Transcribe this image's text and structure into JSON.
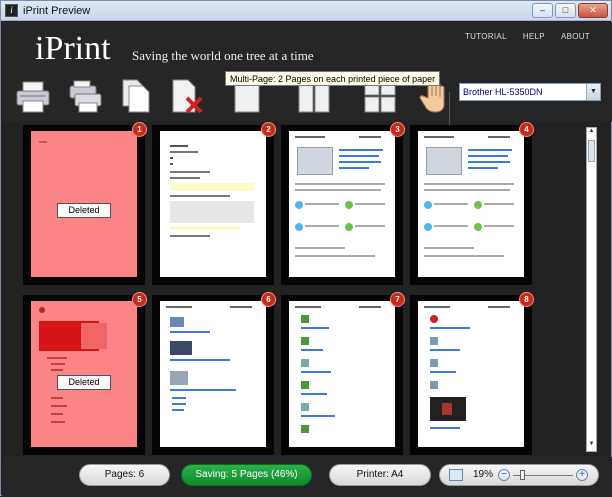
{
  "window": {
    "title": "iPrint Preview",
    "app_icon_letter": "i"
  },
  "header": {
    "logo": "iPrint",
    "tagline": "Saving the world one tree at a time",
    "nav": [
      "TUTORIAL",
      "HELP",
      "ABOUT"
    ]
  },
  "toolbar": {
    "tooltip": "Multi-Page: 2 Pages on each printed piece of paper",
    "printer": "Brother HL-5350DN",
    "icons": [
      "print-icon",
      "print-all-icon",
      "copy-pages-icon",
      "delete-page-icon",
      "single-page-icon",
      "two-up-icon",
      "four-up-icon",
      "hand-pan-icon"
    ]
  },
  "pages": [
    {
      "n": "1",
      "deleted": true,
      "label": "Deleted"
    },
    {
      "n": "2",
      "deleted": false
    },
    {
      "n": "3",
      "deleted": false
    },
    {
      "n": "4",
      "deleted": false
    },
    {
      "n": "5",
      "deleted": true,
      "label": "Deleted"
    },
    {
      "n": "6",
      "deleted": false
    },
    {
      "n": "7",
      "deleted": false
    },
    {
      "n": "8",
      "deleted": false
    }
  ],
  "status": {
    "pages": "Pages: 6",
    "saving": "Saving: 5 Pages (46%)",
    "printer": "Printer: A4",
    "zoom": "19%",
    "zoom_minus": "−",
    "zoom_plus": "+"
  }
}
